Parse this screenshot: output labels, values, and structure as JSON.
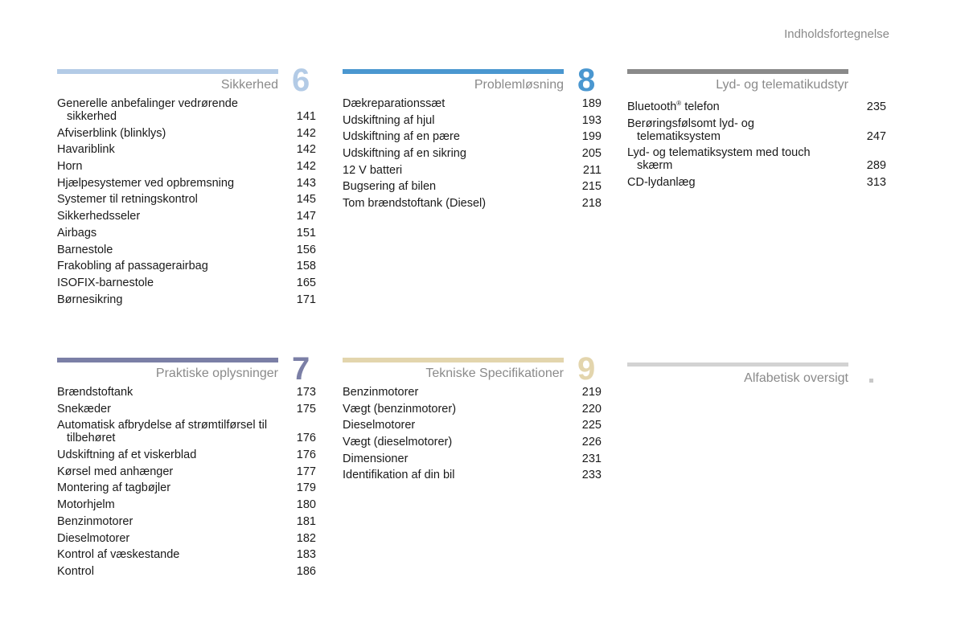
{
  "header": {
    "title": "Indholdsfortegnelse"
  },
  "sections": [
    {
      "number": "6",
      "title": "Sikkerhed",
      "color": "#b3cbe6",
      "entries": [
        {
          "label": "Generelle anbefalinger vedrørende",
          "cont": "sikkerhed",
          "page": "141"
        },
        {
          "label": "Afviserblink (blinklys)",
          "page": "142"
        },
        {
          "label": "Havariblink",
          "page": "142"
        },
        {
          "label": "Horn",
          "page": "142"
        },
        {
          "label": "Hjælpesystemer ved opbremsning",
          "page": "143"
        },
        {
          "label": "Systemer til retningskontrol",
          "page": "145"
        },
        {
          "label": "Sikkerhedsseler",
          "page": "147"
        },
        {
          "label": "Airbags",
          "page": "151"
        },
        {
          "label": "Barnestole",
          "page": "156"
        },
        {
          "label": "Frakobling af passagerairbag",
          "page": "158"
        },
        {
          "label": "ISOFIX-barnestole",
          "page": "165"
        },
        {
          "label": "Børnesikring",
          "page": "171"
        }
      ]
    },
    {
      "number": "8",
      "title": "Problemløsning",
      "color": "#4a97d0",
      "entries": [
        {
          "label": "Dækreparationssæt",
          "page": "189"
        },
        {
          "label": "Udskiftning af hjul",
          "page": "193"
        },
        {
          "label": "Udskiftning af en pære",
          "page": "199"
        },
        {
          "label": "Udskiftning af en sikring",
          "page": "205"
        },
        {
          "label": "12 V batteri",
          "page": "211"
        },
        {
          "label": "Bugsering af bilen",
          "page": "215"
        },
        {
          "label": "Tom brændstoftank (Diesel)",
          "page": "218"
        }
      ]
    },
    {
      "number": "",
      "title": "Lyd- og telematikudstyr",
      "color": "#8a8a8a",
      "entries": [
        {
          "label": "Bluetooth",
          "sup": "®",
          "label_after": " telefon",
          "page": "235"
        },
        {
          "label": "Berøringsfølsomt lyd- og",
          "cont": "telematiksystem",
          "page": "247"
        },
        {
          "label": "Lyd- og telematiksystem med touch",
          "cont": "skærm",
          "page": "289"
        },
        {
          "label": "CD-lydanlæg",
          "page": "313"
        }
      ]
    },
    {
      "number": "7",
      "title": "Praktiske oplysninger",
      "color": "#7b7fa6",
      "entries": [
        {
          "label": "Brændstoftank",
          "page": "173"
        },
        {
          "label": "Snekæder",
          "page": "175"
        },
        {
          "label": "Automatisk afbrydelse af strømtilførsel til",
          "cont": "tilbehøret",
          "page": "176"
        },
        {
          "label": "Udskiftning af et viskerblad",
          "page": "176"
        },
        {
          "label": "Kørsel med anhænger",
          "page": "177"
        },
        {
          "label": "Montering af tagbøjler",
          "page": "179"
        },
        {
          "label": "Motorhjelm",
          "page": "180"
        },
        {
          "label": "Benzinmotorer",
          "page": "181"
        },
        {
          "label": "Dieselmotorer",
          "page": "182"
        },
        {
          "label": "Kontrol af væskestande",
          "page": "183"
        },
        {
          "label": "Kontrol",
          "page": "186"
        }
      ]
    },
    {
      "number": "9",
      "title": "Tekniske Specifikationer",
      "color": "#e3d5ad",
      "entries": [
        {
          "label": "Benzinmotorer",
          "page": "219"
        },
        {
          "label": "Vægt (benzinmotorer)",
          "page": "220"
        },
        {
          "label": "Dieselmotorer",
          "page": "225"
        },
        {
          "label": "Vægt (dieselmotorer)",
          "page": "226"
        },
        {
          "label": "Dimensioner",
          "page": "231"
        },
        {
          "label": "Identifikation af din bil",
          "page": "233"
        }
      ]
    },
    {
      "number": "",
      "title": "Alfabetisk oversigt",
      "color": "#d3d3d3",
      "entries": []
    }
  ]
}
